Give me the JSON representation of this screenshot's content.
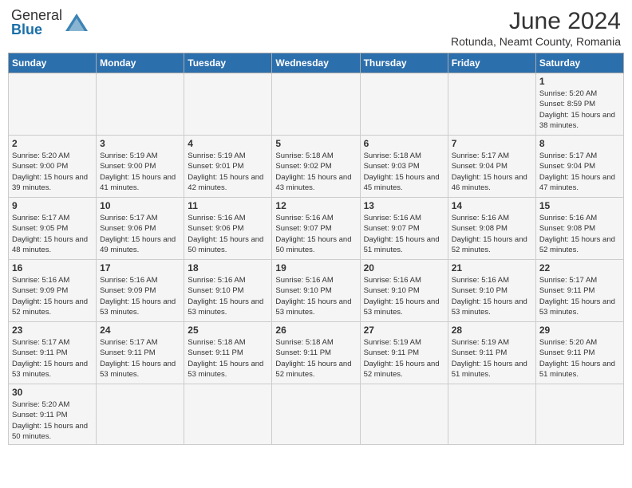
{
  "header": {
    "logo_text_general": "General",
    "logo_text_blue": "Blue",
    "month_title": "June 2024",
    "subtitle": "Rotunda, Neamt County, Romania"
  },
  "days_of_week": [
    "Sunday",
    "Monday",
    "Tuesday",
    "Wednesday",
    "Thursday",
    "Friday",
    "Saturday"
  ],
  "weeks": [
    [
      {
        "day": "",
        "info": ""
      },
      {
        "day": "",
        "info": ""
      },
      {
        "day": "",
        "info": ""
      },
      {
        "day": "",
        "info": ""
      },
      {
        "day": "",
        "info": ""
      },
      {
        "day": "",
        "info": ""
      },
      {
        "day": "1",
        "info": "Sunrise: 5:20 AM\nSunset: 8:59 PM\nDaylight: 15 hours and 38 minutes."
      }
    ],
    [
      {
        "day": "2",
        "info": "Sunrise: 5:20 AM\nSunset: 9:00 PM\nDaylight: 15 hours and 39 minutes."
      },
      {
        "day": "3",
        "info": "Sunrise: 5:19 AM\nSunset: 9:00 PM\nDaylight: 15 hours and 41 minutes."
      },
      {
        "day": "4",
        "info": "Sunrise: 5:19 AM\nSunset: 9:01 PM\nDaylight: 15 hours and 42 minutes."
      },
      {
        "day": "5",
        "info": "Sunrise: 5:18 AM\nSunset: 9:02 PM\nDaylight: 15 hours and 43 minutes."
      },
      {
        "day": "6",
        "info": "Sunrise: 5:18 AM\nSunset: 9:03 PM\nDaylight: 15 hours and 45 minutes."
      },
      {
        "day": "7",
        "info": "Sunrise: 5:17 AM\nSunset: 9:04 PM\nDaylight: 15 hours and 46 minutes."
      },
      {
        "day": "8",
        "info": "Sunrise: 5:17 AM\nSunset: 9:04 PM\nDaylight: 15 hours and 47 minutes."
      }
    ],
    [
      {
        "day": "9",
        "info": "Sunrise: 5:17 AM\nSunset: 9:05 PM\nDaylight: 15 hours and 48 minutes."
      },
      {
        "day": "10",
        "info": "Sunrise: 5:17 AM\nSunset: 9:06 PM\nDaylight: 15 hours and 49 minutes."
      },
      {
        "day": "11",
        "info": "Sunrise: 5:16 AM\nSunset: 9:06 PM\nDaylight: 15 hours and 50 minutes."
      },
      {
        "day": "12",
        "info": "Sunrise: 5:16 AM\nSunset: 9:07 PM\nDaylight: 15 hours and 50 minutes."
      },
      {
        "day": "13",
        "info": "Sunrise: 5:16 AM\nSunset: 9:07 PM\nDaylight: 15 hours and 51 minutes."
      },
      {
        "day": "14",
        "info": "Sunrise: 5:16 AM\nSunset: 9:08 PM\nDaylight: 15 hours and 52 minutes."
      },
      {
        "day": "15",
        "info": "Sunrise: 5:16 AM\nSunset: 9:08 PM\nDaylight: 15 hours and 52 minutes."
      }
    ],
    [
      {
        "day": "16",
        "info": "Sunrise: 5:16 AM\nSunset: 9:09 PM\nDaylight: 15 hours and 52 minutes."
      },
      {
        "day": "17",
        "info": "Sunrise: 5:16 AM\nSunset: 9:09 PM\nDaylight: 15 hours and 53 minutes."
      },
      {
        "day": "18",
        "info": "Sunrise: 5:16 AM\nSunset: 9:10 PM\nDaylight: 15 hours and 53 minutes."
      },
      {
        "day": "19",
        "info": "Sunrise: 5:16 AM\nSunset: 9:10 PM\nDaylight: 15 hours and 53 minutes."
      },
      {
        "day": "20",
        "info": "Sunrise: 5:16 AM\nSunset: 9:10 PM\nDaylight: 15 hours and 53 minutes."
      },
      {
        "day": "21",
        "info": "Sunrise: 5:16 AM\nSunset: 9:10 PM\nDaylight: 15 hours and 53 minutes."
      },
      {
        "day": "22",
        "info": "Sunrise: 5:17 AM\nSunset: 9:11 PM\nDaylight: 15 hours and 53 minutes."
      }
    ],
    [
      {
        "day": "23",
        "info": "Sunrise: 5:17 AM\nSunset: 9:11 PM\nDaylight: 15 hours and 53 minutes."
      },
      {
        "day": "24",
        "info": "Sunrise: 5:17 AM\nSunset: 9:11 PM\nDaylight: 15 hours and 53 minutes."
      },
      {
        "day": "25",
        "info": "Sunrise: 5:18 AM\nSunset: 9:11 PM\nDaylight: 15 hours and 53 minutes."
      },
      {
        "day": "26",
        "info": "Sunrise: 5:18 AM\nSunset: 9:11 PM\nDaylight: 15 hours and 52 minutes."
      },
      {
        "day": "27",
        "info": "Sunrise: 5:19 AM\nSunset: 9:11 PM\nDaylight: 15 hours and 52 minutes."
      },
      {
        "day": "28",
        "info": "Sunrise: 5:19 AM\nSunset: 9:11 PM\nDaylight: 15 hours and 51 minutes."
      },
      {
        "day": "29",
        "info": "Sunrise: 5:20 AM\nSunset: 9:11 PM\nDaylight: 15 hours and 51 minutes."
      }
    ],
    [
      {
        "day": "30",
        "info": "Sunrise: 5:20 AM\nSunset: 9:11 PM\nDaylight: 15 hours and 50 minutes."
      },
      {
        "day": "",
        "info": ""
      },
      {
        "day": "",
        "info": ""
      },
      {
        "day": "",
        "info": ""
      },
      {
        "day": "",
        "info": ""
      },
      {
        "day": "",
        "info": ""
      },
      {
        "day": "",
        "info": ""
      }
    ]
  ]
}
